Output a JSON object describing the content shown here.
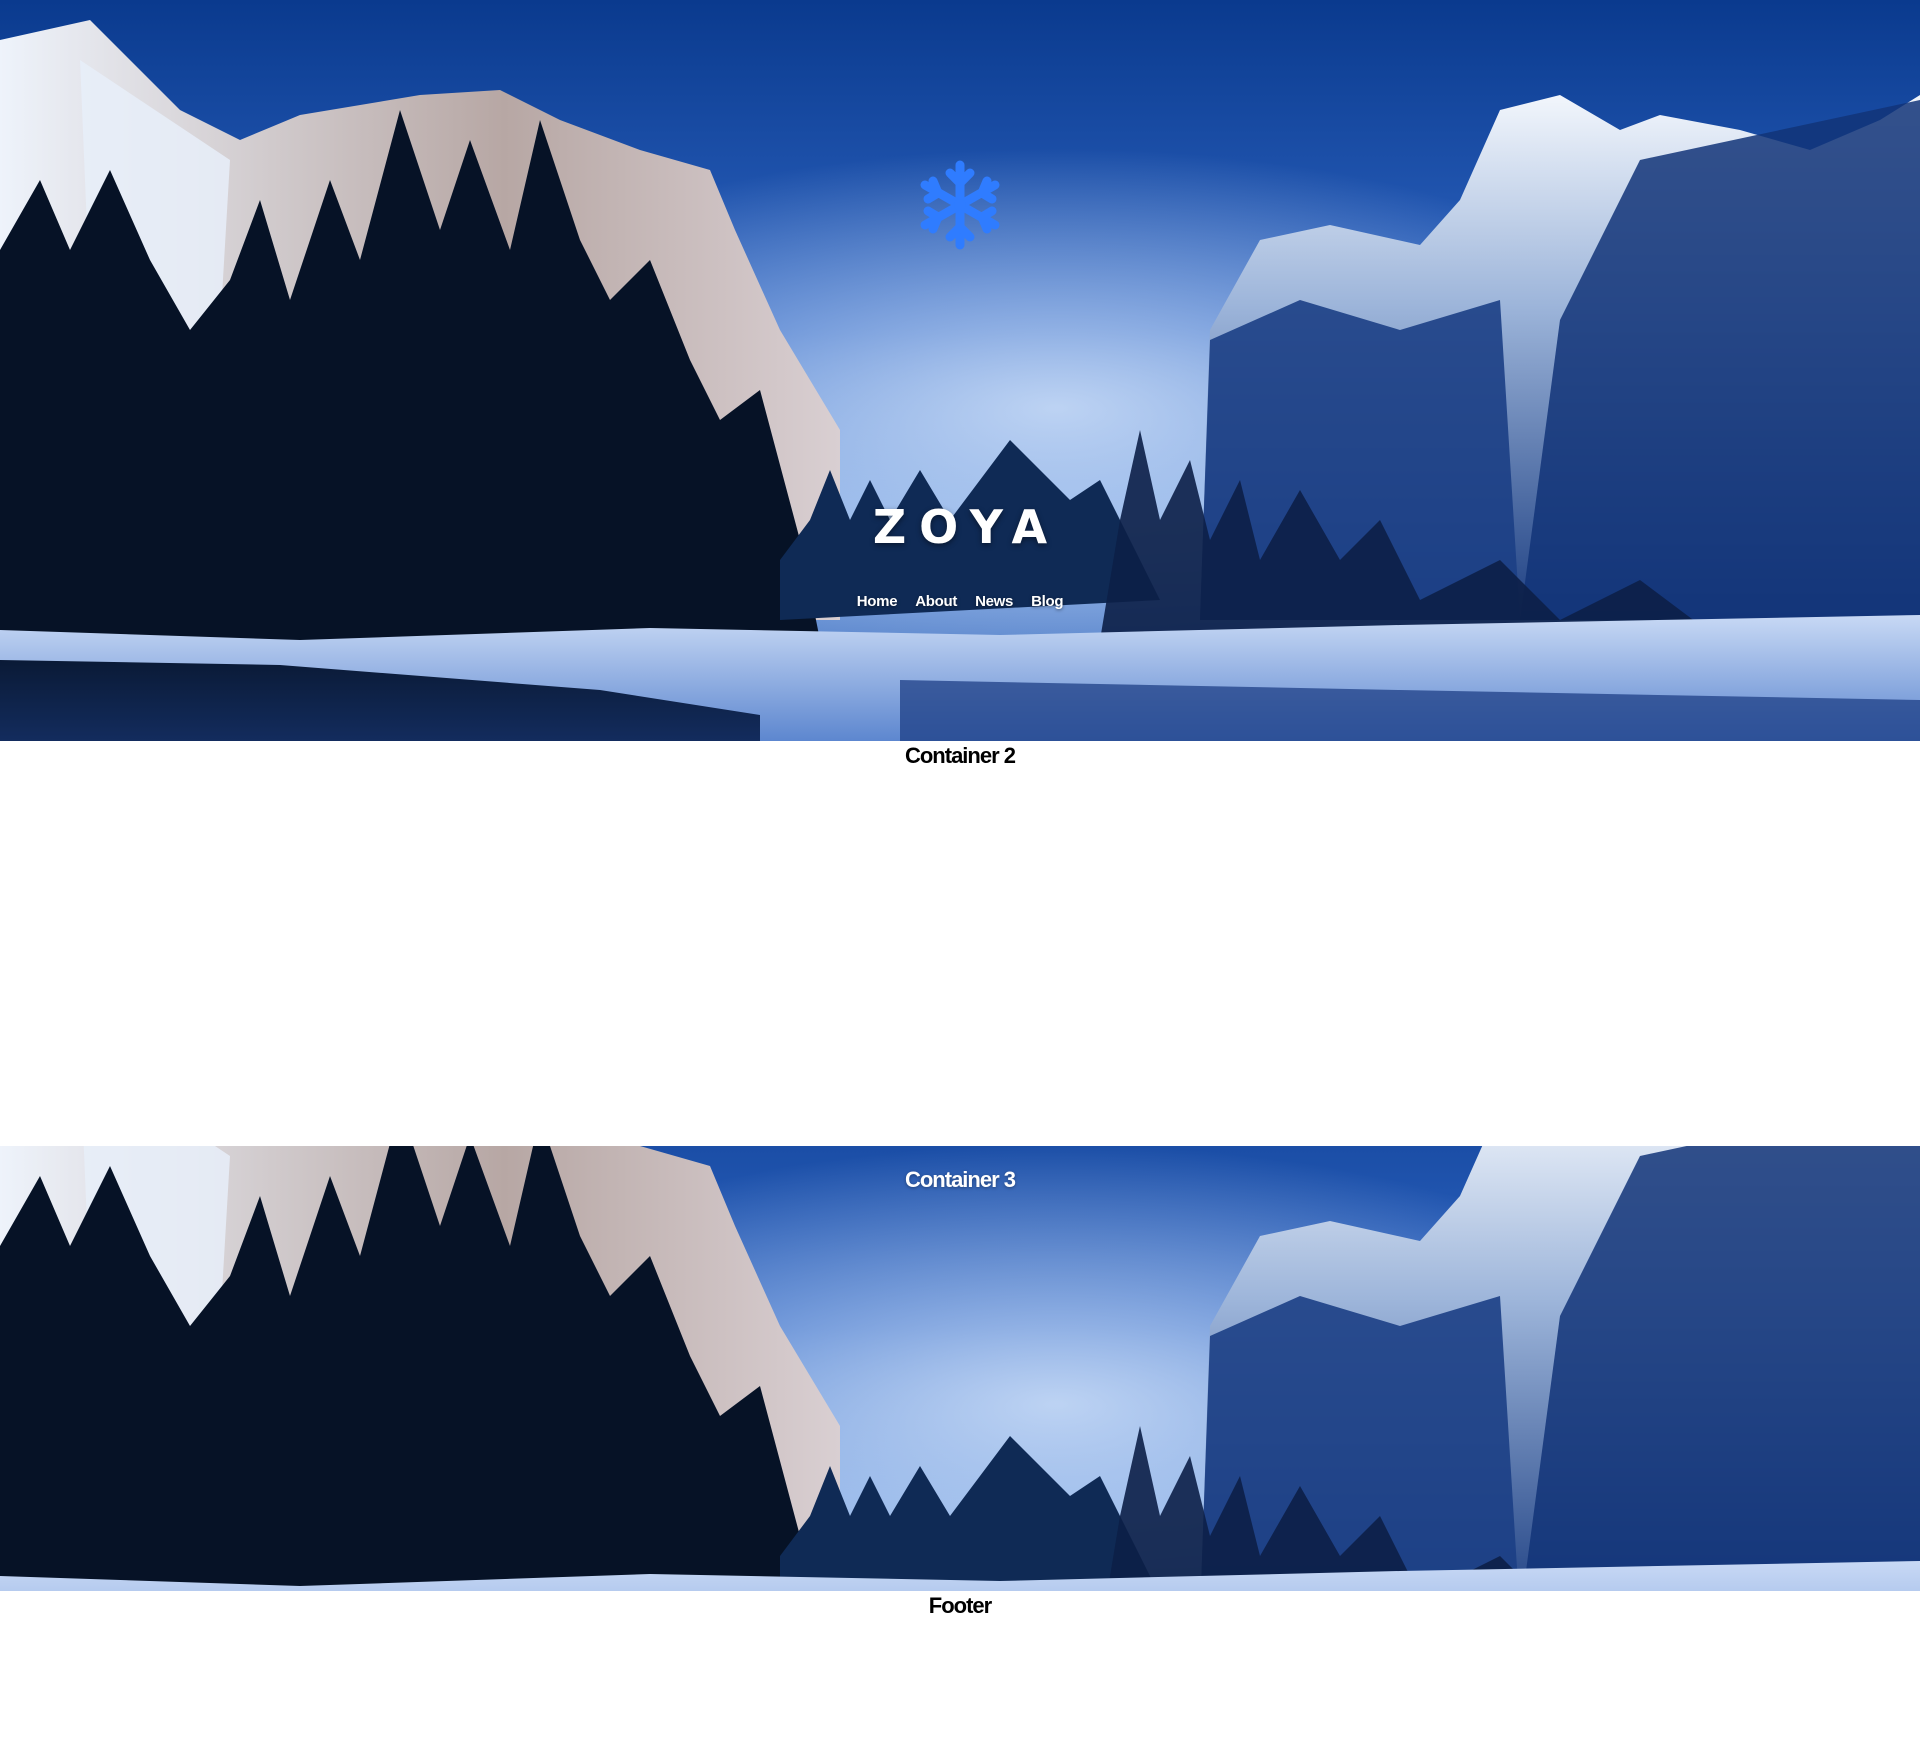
{
  "hero": {
    "logo_icon": "snowflake-icon",
    "logo_color": "#2f7cff",
    "brand": "ZOYA",
    "nav": [
      {
        "label": "Home"
      },
      {
        "label": "About"
      },
      {
        "label": "News"
      },
      {
        "label": "Blog"
      }
    ]
  },
  "container2": {
    "title": "Container 2"
  },
  "container3": {
    "title": "Container 3"
  },
  "footer": {
    "title": "Footer"
  },
  "colors": {
    "sky_top": "#0b3d91",
    "sky_light": "#6f9ee0",
    "snow": "#dde8f8",
    "forest": "#061226",
    "text_light": "#ffffff",
    "text_dark": "#000000"
  }
}
